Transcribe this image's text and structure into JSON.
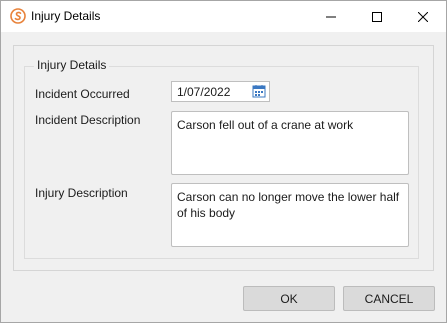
{
  "window": {
    "title": "Injury Details",
    "icon": "app-logo-icon",
    "controls": [
      "minimize-icon",
      "maximize-icon",
      "close-icon"
    ]
  },
  "group": {
    "legend": "Injury Details"
  },
  "fields": {
    "incident_occurred_label": "Incident Occurred",
    "incident_occurred_value": "1/07/2022",
    "incident_description_label": "Incident Description",
    "incident_description_value": "Carson fell out of a crane at work",
    "injury_description_label": "Injury Description",
    "injury_description_value": "Carson can no longer move the lower half of his body"
  },
  "buttons": {
    "ok_label": "OK",
    "cancel_label": "CANCEL"
  },
  "colors": {
    "accent_orange": "#e8823a",
    "calendar_blue": "#3b78c2",
    "button_bg": "#dadada",
    "dialog_bg": "#f0f0f0"
  }
}
